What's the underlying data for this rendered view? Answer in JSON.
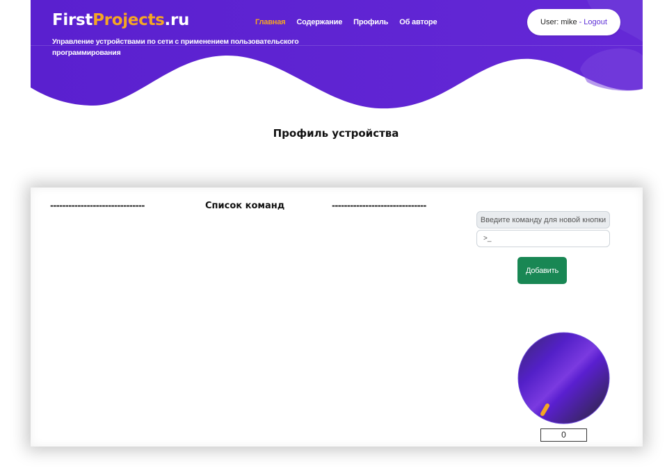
{
  "header": {
    "logo": {
      "part_a": "First",
      "part_b": "Projects",
      "part_c": ".ru"
    },
    "subtitle": "Управление устройствами по сети с применением пользовательского программирования",
    "nav": [
      {
        "label": "Главная",
        "active": true
      },
      {
        "label": "Содержание",
        "active": false
      },
      {
        "label": "Профиль",
        "active": false
      },
      {
        "label": "Об авторе",
        "active": false
      }
    ],
    "user": {
      "label": "User: mike",
      "separator": "-",
      "logout": "Logout"
    }
  },
  "colors": {
    "brand_purple": "#5b22d1",
    "accent_orange": "#f5a623",
    "button_green": "#198754"
  },
  "main": {
    "title": "Профиль устройства"
  },
  "commands": {
    "dash_left": "-------------------------------",
    "title": "Список команд",
    "dash_right": "-------------------------------",
    "input_label": "Введите команду для новой кнопки",
    "input_placeholder": ">_",
    "add_button": "Добавить"
  },
  "knob": {
    "icon": "rotary-knob",
    "value": "0"
  }
}
